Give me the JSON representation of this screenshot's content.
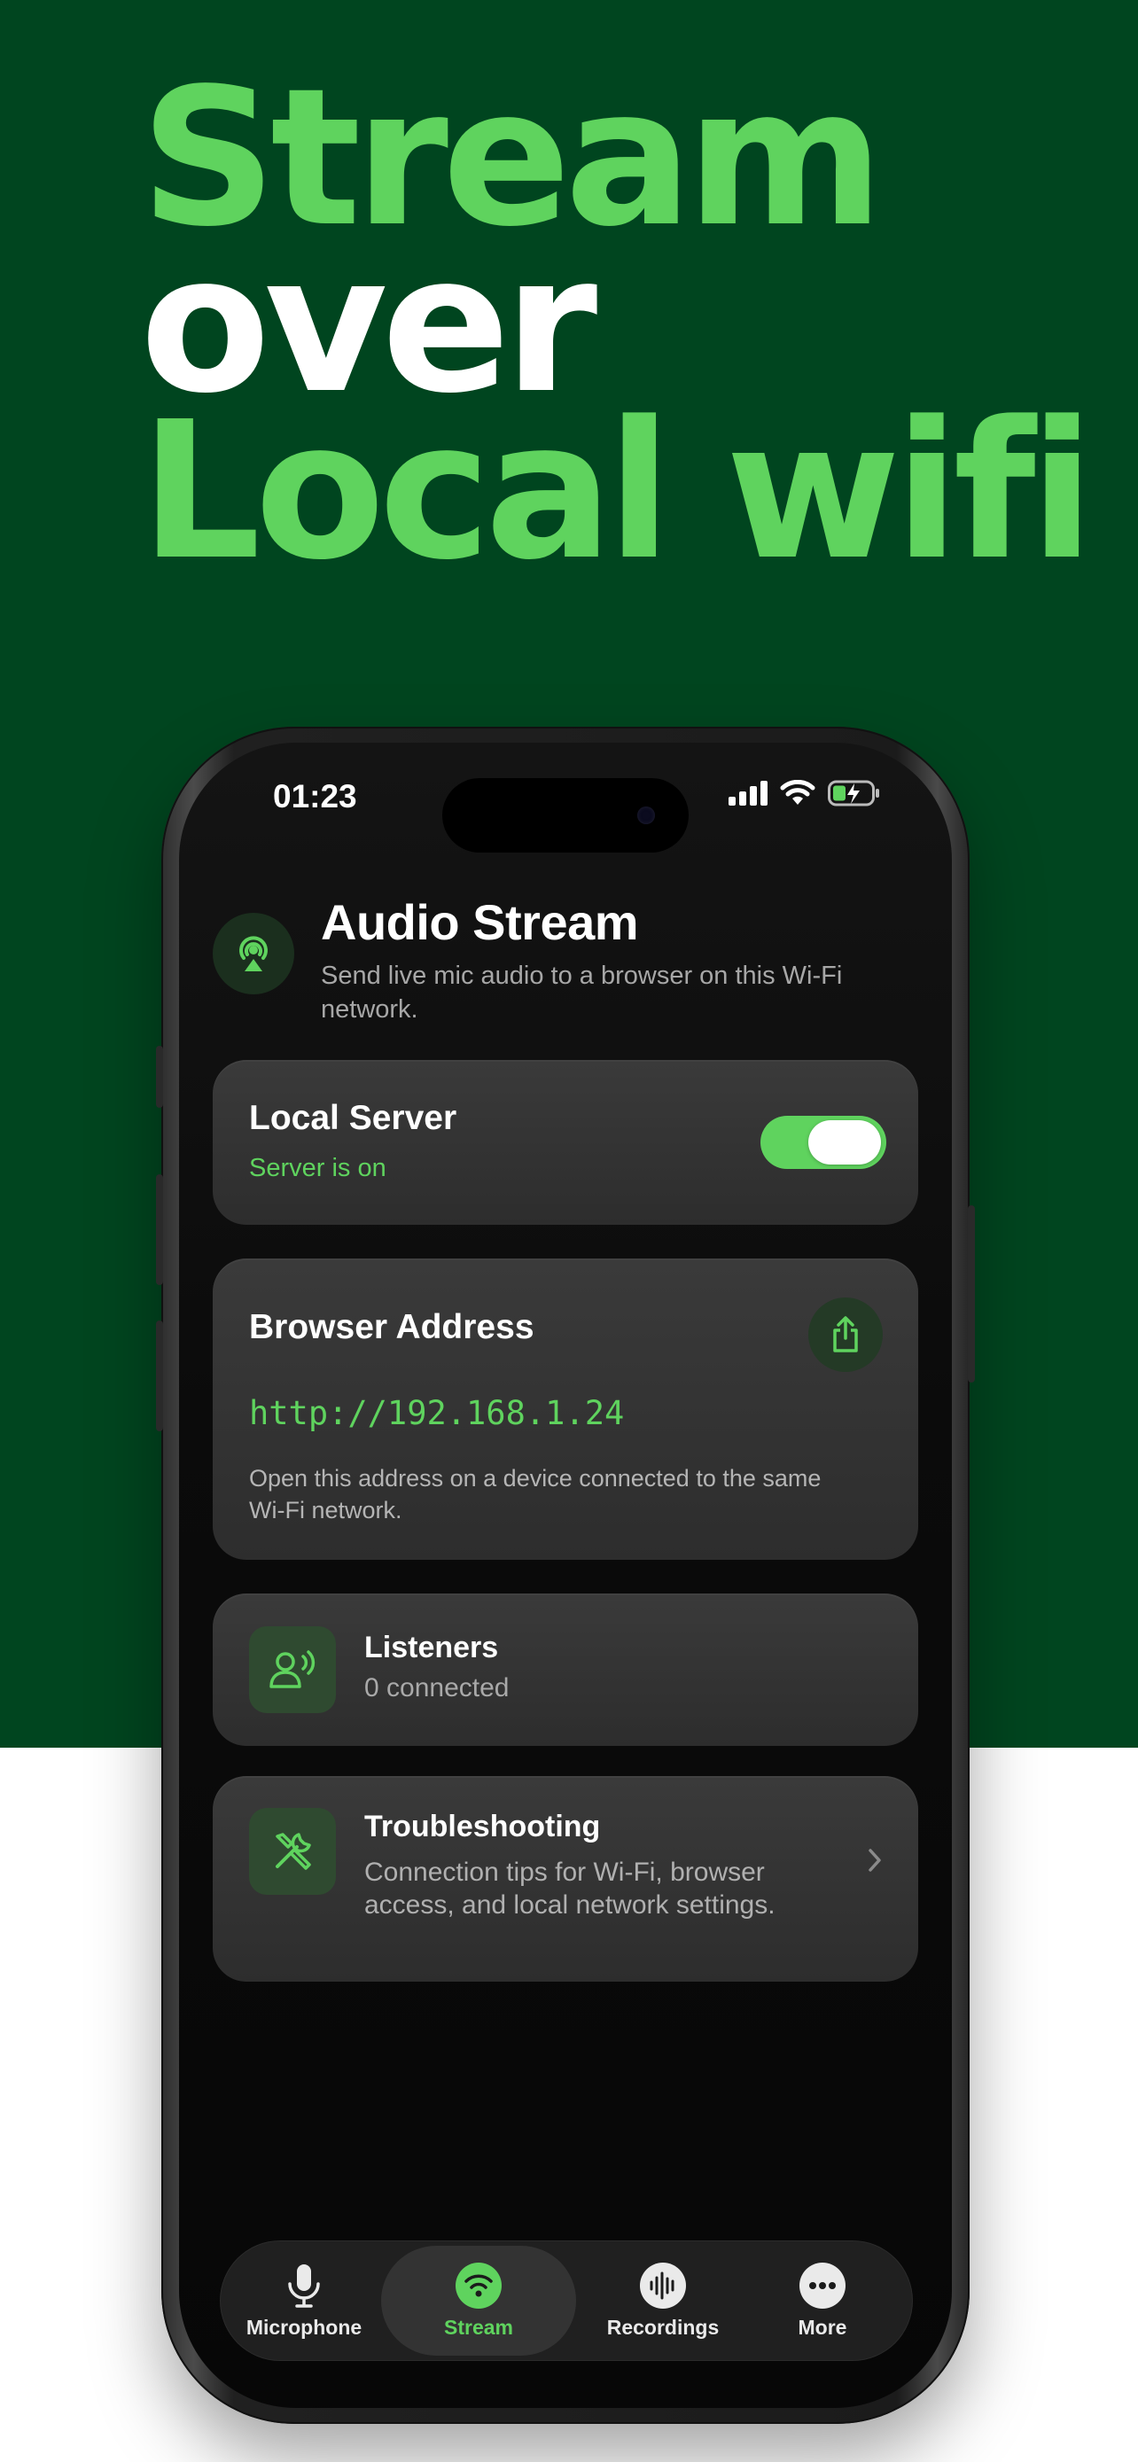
{
  "hero": {
    "line1": "Stream",
    "line2": "over",
    "line3": "Local wifi"
  },
  "status_bar": {
    "time": "01:23"
  },
  "header": {
    "title": "Audio Stream",
    "subtitle": "Send live mic audio to a browser on this Wi-Fi network."
  },
  "server_card": {
    "title": "Local Server",
    "status": "Server is on"
  },
  "address_card": {
    "title": "Browser Address",
    "url": "http://192.168.1.24",
    "hint": "Open this address on a device connected to the same Wi-Fi network."
  },
  "listeners_card": {
    "title": "Listeners",
    "count_text": "0 connected"
  },
  "troubleshooting_card": {
    "title": "Troubleshooting",
    "description": "Connection tips for Wi-Fi, browser access, and local network settings."
  },
  "tabbar": {
    "tabs": [
      {
        "label": "Microphone",
        "icon": "microphone-icon"
      },
      {
        "label": "Stream",
        "icon": "wifi-icon"
      },
      {
        "label": "Recordings",
        "icon": "waveform-icon"
      },
      {
        "label": "More",
        "icon": "ellipsis-icon"
      }
    ],
    "active": "Stream"
  },
  "colors": {
    "brand_green": "#5fd35e",
    "hero_bg": "#00451f"
  }
}
